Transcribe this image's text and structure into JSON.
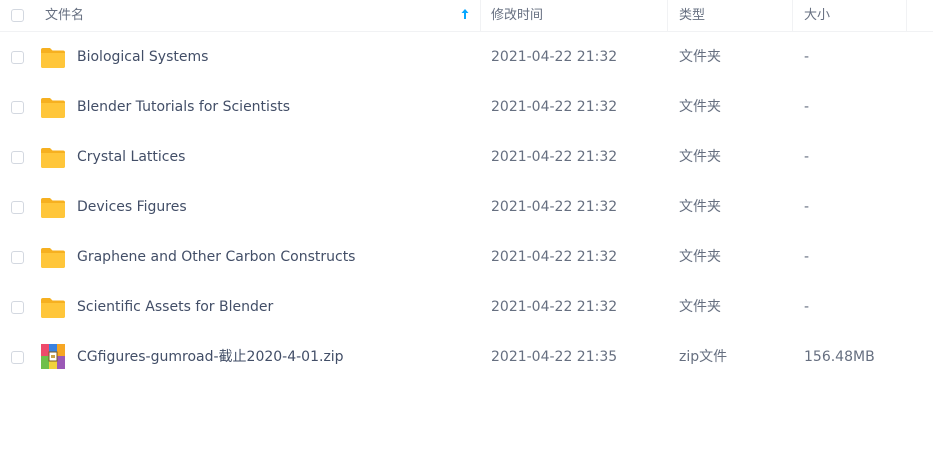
{
  "header": {
    "name_label": "文件名",
    "time_label": "修改时间",
    "type_label": "类型",
    "size_label": "大小",
    "sort_icon": "arrow-up-icon",
    "sort_color": "#06a7ff"
  },
  "colors": {
    "folder": "#ffc63a",
    "folder_tab": "#f6b020"
  },
  "files": [
    {
      "name": "Biological Systems",
      "time": "2021-04-22 21:32",
      "type": "文件夹",
      "size": "-",
      "icon": "folder-icon"
    },
    {
      "name": "Blender Tutorials for Scientists",
      "time": "2021-04-22 21:32",
      "type": "文件夹",
      "size": "-",
      "icon": "folder-icon"
    },
    {
      "name": "Crystal Lattices",
      "time": "2021-04-22 21:32",
      "type": "文件夹",
      "size": "-",
      "icon": "folder-icon"
    },
    {
      "name": "Devices Figures",
      "time": "2021-04-22 21:32",
      "type": "文件夹",
      "size": "-",
      "icon": "folder-icon"
    },
    {
      "name": "Graphene and Other Carbon Constructs",
      "time": "2021-04-22 21:32",
      "type": "文件夹",
      "size": "-",
      "icon": "folder-icon"
    },
    {
      "name": "Scientific Assets for Blender",
      "time": "2021-04-22 21:32",
      "type": "文件夹",
      "size": "-",
      "icon": "folder-icon"
    },
    {
      "name": "CGfigures-gumroad-截止2020-4-01.zip",
      "time": "2021-04-22 21:35",
      "type": "zip文件",
      "size": "156.48MB",
      "icon": "zip-archive-icon"
    }
  ]
}
